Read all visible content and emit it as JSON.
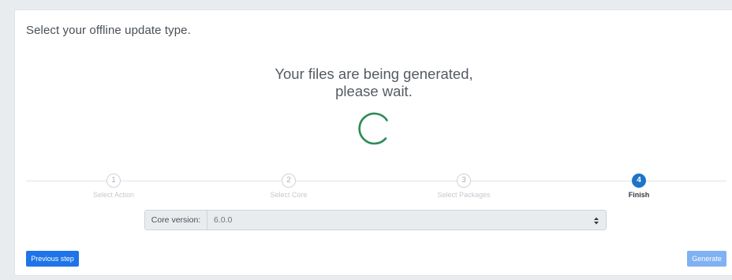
{
  "card": {
    "title": "Select your offline update type."
  },
  "status": {
    "line1": "Your files are being generated,",
    "line2": "please wait."
  },
  "colors": {
    "spinner": "#2e8b57",
    "primary": "#1e74e8",
    "active_step": "#1e74c8"
  },
  "stepper": {
    "steps": [
      {
        "number": "1",
        "label": "Select Action"
      },
      {
        "number": "2",
        "label": "Select Core"
      },
      {
        "number": "3",
        "label": "Select Packages"
      },
      {
        "number": "4",
        "label": "Finish"
      }
    ],
    "active_step": 4
  },
  "core": {
    "label": "Core version:",
    "value": "6.0.0"
  },
  "buttons": {
    "previous": "Previous step",
    "generate": "Generate"
  }
}
